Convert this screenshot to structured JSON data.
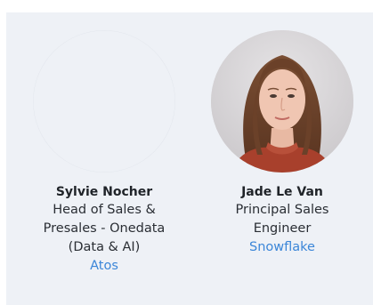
{
  "speakers": [
    {
      "name": "Sylvie Nocher",
      "role_lines": [
        "Head of Sales &",
        "Presales - Onedata",
        "(Data & AI)"
      ],
      "company": "Atos"
    },
    {
      "name": "Jade Le Van",
      "role_lines": [
        "Principal Sales",
        "Engineer"
      ],
      "company": "Snowflake"
    }
  ],
  "colors": {
    "panel_bg": "#eef1f6",
    "name_text": "#1f2328",
    "link": "#3b86d8"
  }
}
